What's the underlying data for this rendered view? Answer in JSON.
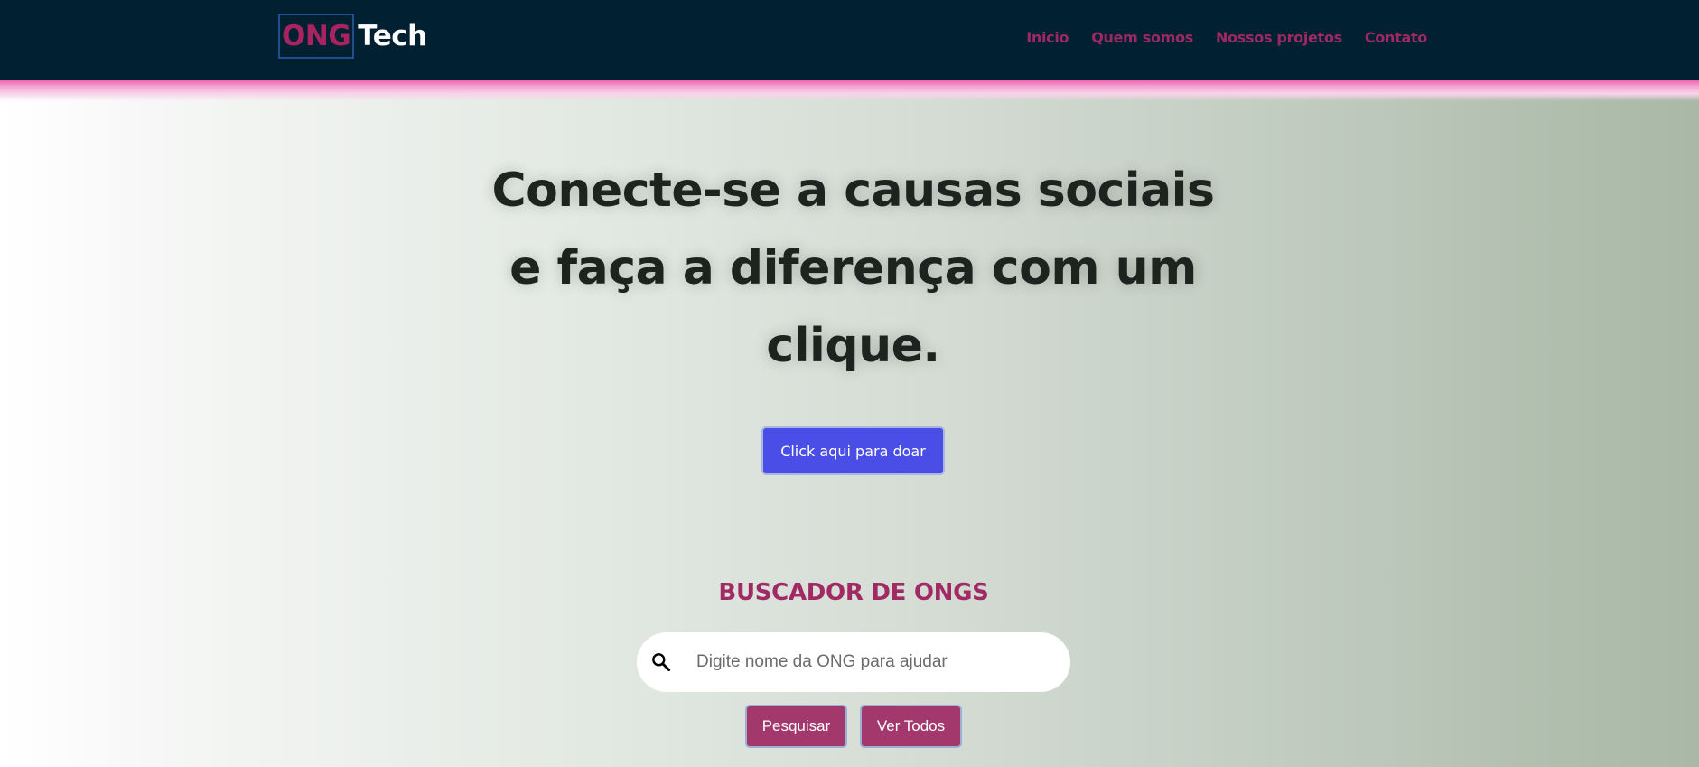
{
  "header": {
    "logo_part1": "ONG",
    "logo_part2": "Tech",
    "nav": [
      "Inicio",
      "Quem somos",
      "Nossos projetos",
      "Contato"
    ]
  },
  "hero": {
    "title": "Conecte-se a causas sociais e faça a diferença com um clique.",
    "donate_label": "Click aqui para doar"
  },
  "search": {
    "title": "BUSCADOR DE ONGS",
    "placeholder": "Digite nome da ONG para ajudar",
    "search_label": "Pesquisar",
    "view_all_label": "Ver Todos",
    "icon": "search-icon"
  },
  "colors": {
    "header_bg": "#012132",
    "accent_magenta": "#a12a65",
    "donate_blue": "#4a4ee6",
    "stripe_pink": "#f05aa8"
  }
}
